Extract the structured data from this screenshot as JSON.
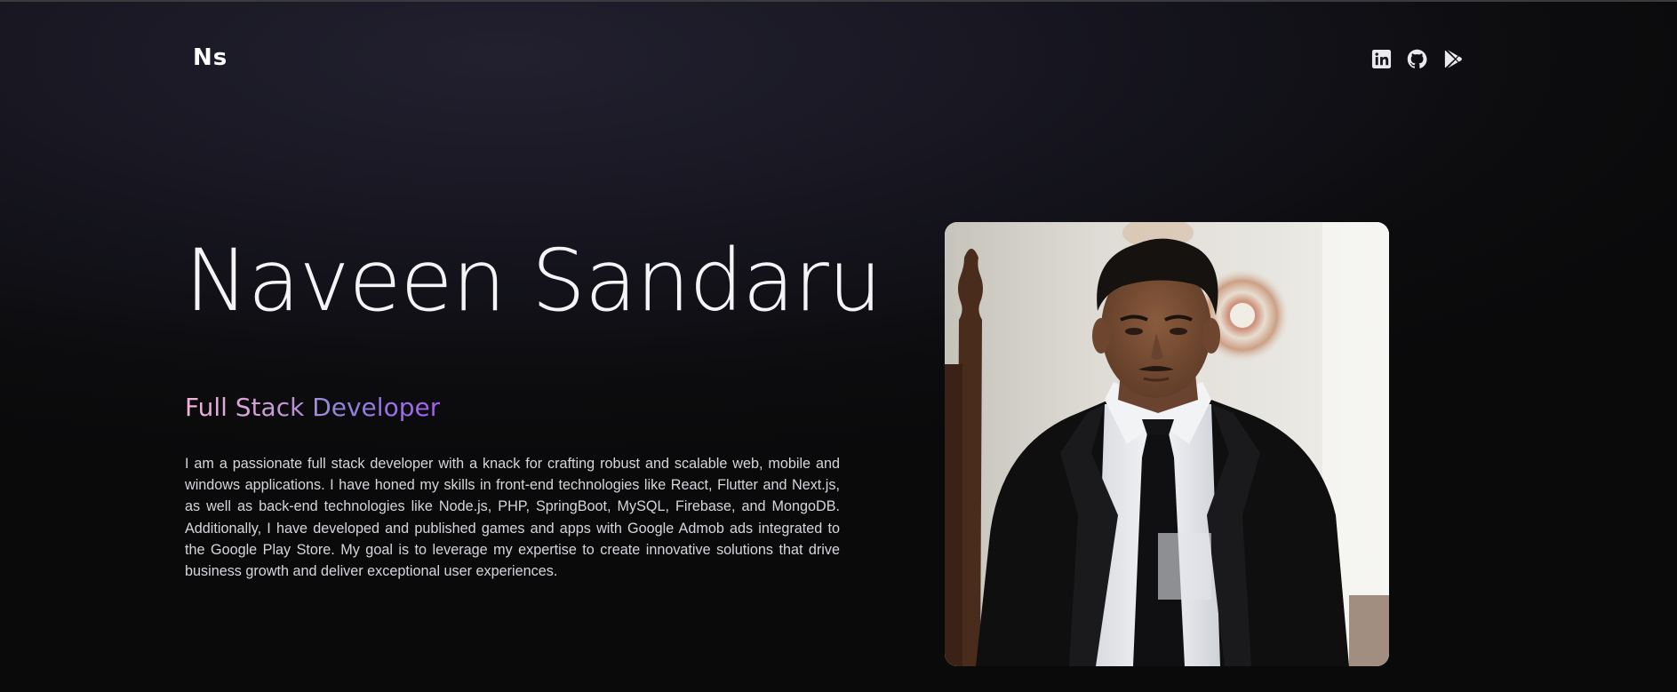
{
  "header": {
    "logo_text": "Ns",
    "social": [
      {
        "icon": "linkedin-icon"
      },
      {
        "icon": "github-icon"
      },
      {
        "icon": "google-play-icon"
      }
    ]
  },
  "hero": {
    "name": "Naveen Sandaru",
    "role": "Full Stack Developer",
    "bio": "I am a passionate full stack developer with a knack for crafting robust and scalable web, mobile and windows applications. I have honed my skills in front-end technologies like React, Flutter and Next.js, as well as back-end technologies like Node.js, PHP, SpringBoot, MySQL, Firebase, and MongoDB. Additionally, I have developed and published games and apps with Google Admob ads integrated to the Google Play Store. My goal is to leverage my expertise to create innovative solutions that drive business growth and deliver exceptional user experiences.",
    "photo_alt": "portrait-photo"
  },
  "colors": {
    "background": "#0c0c0e",
    "text": "#f4f4f6",
    "gradient_start": "#f5b5d8",
    "gradient_end": "#a35ff0"
  }
}
